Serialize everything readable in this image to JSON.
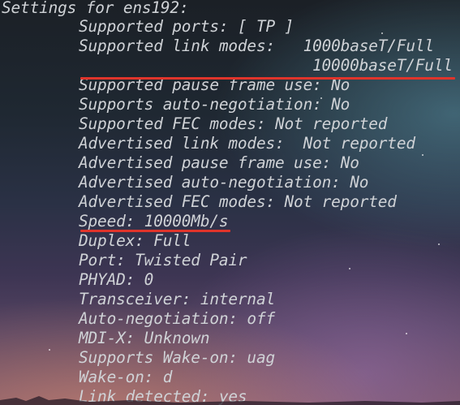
{
  "terminal": {
    "header": "Settings for ens192:",
    "lines": [
      "Supported ports: [ TP ]",
      "Supported link modes:   1000baseT/Full",
      "10000baseT/Full",
      "Supported pause frame use: No",
      "Supports auto-negotiation: No",
      "Supported FEC modes: Not reported",
      "Advertised link modes:  Not reported",
      "Advertised pause frame use: No",
      "Advertised auto-negotiation: No",
      "Advertised FEC modes: Not reported",
      "Speed: 10000Mb/s",
      "Duplex: Full",
      "Port: Twisted Pair",
      "PHYAD: 0",
      "Transceiver: internal",
      "Auto-negotiation: off",
      "MDI-X: Unknown",
      "Supports Wake-on: uag",
      "Wake-on: d",
      "Link detected: yes"
    ]
  },
  "colors": {
    "text": "#cfd2d6",
    "highlight_underline": "#e0342b"
  }
}
